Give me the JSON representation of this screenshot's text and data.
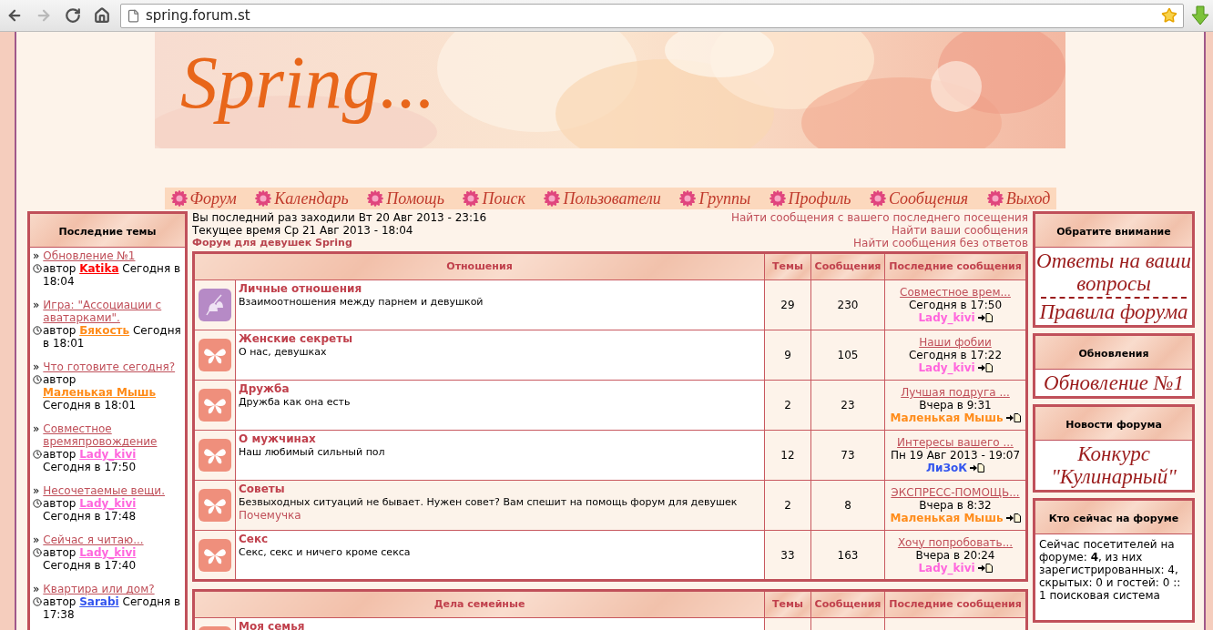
{
  "browser": {
    "url": "spring.forum.st",
    "nav_buttons": [
      {
        "kind": "back",
        "disabled": false
      },
      {
        "kind": "forward",
        "disabled": true
      },
      {
        "kind": "reload",
        "disabled": false
      },
      {
        "kind": "home",
        "disabled": false
      }
    ]
  },
  "banner": {
    "logo": "Spring..."
  },
  "nav": [
    "Форум",
    "Календарь",
    "Помощь",
    "Поиск",
    "Пользователи",
    "Группы",
    "Профиль",
    "Сообщения",
    "Выход"
  ],
  "recent_topics": {
    "title": "Последние темы",
    "items": [
      {
        "marker": "»",
        "title": "Обновление №1",
        "by": "автор",
        "author": "Katika",
        "color": "#ff0000",
        "time": "Сегодня в 18:04"
      },
      {
        "marker": "»",
        "title": "Игра: \"Ассоциации с аватарками\".",
        "by": "автор",
        "author": "Бякость",
        "color": "#ff8c1a",
        "time": "Сегодня в 18:01"
      },
      {
        "marker": "»",
        "title": "Что готовите сегодня?",
        "by": "автор",
        "author": "Маленькая Мышь",
        "color": "#ff8c1a",
        "time": "Сегодня в 18:01"
      },
      {
        "marker": "»",
        "title": "Совместное времяпровождение",
        "by": "автор",
        "author": "Lady_kivi",
        "color": "#ff66dd",
        "time": "Сегодня в 17:50"
      },
      {
        "marker": "»",
        "title": "Несочетаемые вещи.",
        "by": "автор",
        "author": "Lady_kivi",
        "color": "#ff66dd",
        "time": "Сегодня в 17:48"
      },
      {
        "marker": "»",
        "title": "Сейчас я читаю...",
        "by": "автор",
        "author": "Lady_kivi",
        "color": "#ff66dd",
        "time": "Сегодня в 17:40"
      },
      {
        "marker": "»",
        "title": "Квартира или дом?",
        "by": "автор",
        "author": "Sarabi",
        "color": "#3355ee",
        "time": "Сегодня в 17:38"
      }
    ]
  },
  "info": {
    "last_visit": "Вы последний раз заходили Вт 20 Авг 2013 - 23:16",
    "current_time": "Текущее время Ср 21 Авг 2013 - 18:04",
    "forum_name": "Форум для девушек Spring",
    "links": [
      "Найти сообщения с вашего последнего посещения",
      "Найти ваши сообщения",
      "Найти сообщения без ответов"
    ]
  },
  "categories": [
    {
      "title": "Отношения",
      "columns": [
        "Темы",
        "Сообщения",
        "Последние сообщения"
      ],
      "forums": [
        {
          "kind": "bells",
          "name": "Личные отношения",
          "description": "Взаимоотношения между парнем и девушкой",
          "highlighted": false,
          "topics": "29",
          "posts": "230",
          "last": {
            "title": "Совместное врем...",
            "time": "Сегодня в 17:50",
            "author": "Lady_kivi",
            "color": "#ff66dd"
          }
        },
        {
          "kind": "butterfly",
          "name": "Женские секреты",
          "description": "О нас, девушках",
          "highlighted": false,
          "topics": "9",
          "posts": "105",
          "last": {
            "title": "Наши фобии",
            "time": "Сегодня в 17:22",
            "author": "Lady_kivi",
            "color": "#ff66dd"
          }
        },
        {
          "kind": "butterfly",
          "name": "Дружба",
          "description": "Дружба как она есть",
          "highlighted": false,
          "topics": "2",
          "posts": "23",
          "last": {
            "title": "Лучшая подруга ...",
            "time": "Вчера в 9:31",
            "author": "Маленькая Мышь",
            "color": "#ff8c1a"
          }
        },
        {
          "kind": "butterfly",
          "name": "О мужчинах",
          "description": "Наш любимый сильный пол",
          "highlighted": false,
          "topics": "12",
          "posts": "73",
          "last": {
            "title": "Интересы вашего ...",
            "time": "Пн 19 Авг 2013 - 19:07",
            "author": "ЛиЗоК",
            "color": "#3355ee"
          }
        },
        {
          "kind": "butterfly",
          "name": "Советы",
          "description": "Безвыходных ситуаций не бывает. Нужен совет? Вам спешит на помощь форум для девушек",
          "subforum": "Почемучка",
          "highlighted": true,
          "topics": "2",
          "posts": "8",
          "last": {
            "title": "ЭКСПРЕСС-ПОМОЩЬ...",
            "time": "Вчера в 8:32",
            "author": "Маленькая Мышь",
            "color": "#ff8c1a"
          }
        },
        {
          "kind": "butterfly",
          "name": "Секс",
          "description": "Секс, секс и ничего кроме секса",
          "highlighted": false,
          "topics": "33",
          "posts": "163",
          "last": {
            "title": "Хочу попробовать...",
            "time": "Вчера в 20:24",
            "author": "Lady_kivi",
            "color": "#ff66dd"
          }
        }
      ]
    },
    {
      "title": "Дела семейные",
      "columns": [
        "Темы",
        "Сообщения",
        "Последние сообщения"
      ],
      "forums": [
        {
          "kind": "butterfly",
          "name": "Моя семья",
          "highlighted": false
        }
      ]
    }
  ],
  "right_blocks": [
    {
      "title": "Обратите внимание",
      "kind": "banners",
      "lines": [
        "Ответы на ваши вопросы",
        "Правила форума"
      ]
    },
    {
      "title": "Обновления",
      "kind": "banners",
      "lines": [
        "Обновление №1"
      ]
    },
    {
      "title": "Новости форума",
      "kind": "banners",
      "lines": [
        "Конкурс \"Кулинарный\""
      ]
    },
    {
      "title": "Кто сейчас на форуме",
      "kind": "text",
      "text": "Сейчас посетителей на форуме: **4**, из них зарегистрированных: 4, скрытых: 0 и гостей: 0 :: 1 поисковая система"
    }
  ]
}
